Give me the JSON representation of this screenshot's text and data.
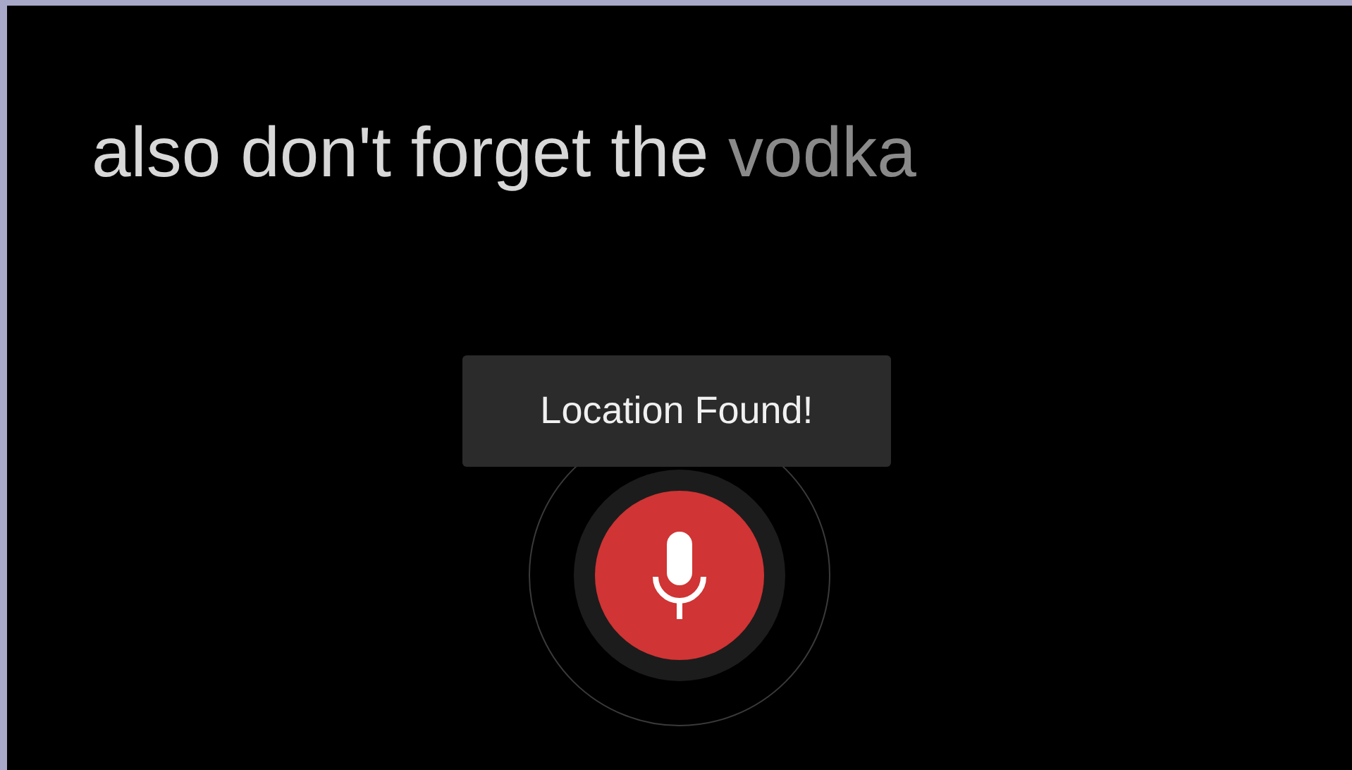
{
  "transcript": {
    "recognized": "also don't forget the",
    "pending": "vodka"
  },
  "toast": {
    "text": "Location Found!"
  },
  "mic_button": {
    "listening": true
  }
}
